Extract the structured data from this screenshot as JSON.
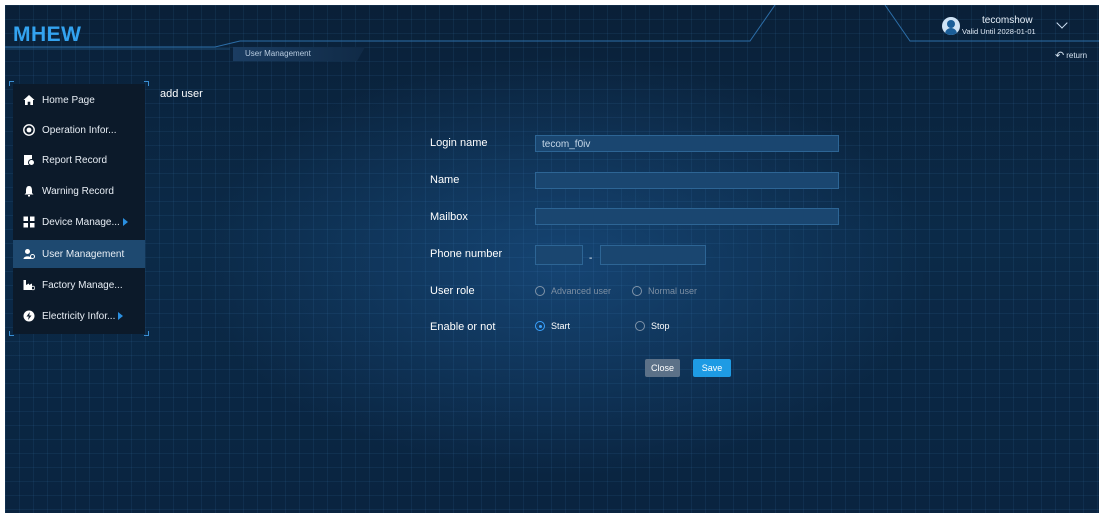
{
  "app": {
    "logo": "MHEW"
  },
  "header": {
    "breadcrumb": "User Management",
    "user": {
      "name": "tecomshow",
      "validity": "Valid Until 2028-01-01"
    },
    "return_label": "return"
  },
  "sidebar": {
    "items": [
      {
        "label": "Home Page",
        "icon": "home-icon"
      },
      {
        "label": "Operation Infor...",
        "icon": "operation-icon"
      },
      {
        "label": "Report Record",
        "icon": "report-icon"
      },
      {
        "label": "Warning Record",
        "icon": "bell-icon"
      },
      {
        "label": "Device Manage...",
        "icon": "device-icon",
        "submenu": true
      },
      {
        "label": "User Management",
        "icon": "user-icon",
        "active": true
      },
      {
        "label": "Factory Manage...",
        "icon": "factory-icon"
      },
      {
        "label": "Electricity Infor...",
        "icon": "electricity-icon",
        "submenu": true
      }
    ]
  },
  "page": {
    "title": "add user"
  },
  "form": {
    "login_name": {
      "label": "Login name",
      "value": "tecom_f0iv"
    },
    "name": {
      "label": "Name",
      "value": ""
    },
    "mailbox": {
      "label": "Mailbox",
      "value": ""
    },
    "phone": {
      "label": "Phone number",
      "separator": "-",
      "prefix": "",
      "number": ""
    },
    "user_role": {
      "label": "User role",
      "options": [
        "Advanced user",
        "Normal user"
      ],
      "selected": null
    },
    "enable": {
      "label": "Enable or not",
      "options": [
        "Start",
        "Stop"
      ],
      "selected": "Start"
    },
    "buttons": {
      "close": "Close",
      "save": "Save"
    }
  },
  "colors": {
    "accent": "#1e9be4",
    "logo": "#33a3f0",
    "active_nav": "#1e4970"
  }
}
